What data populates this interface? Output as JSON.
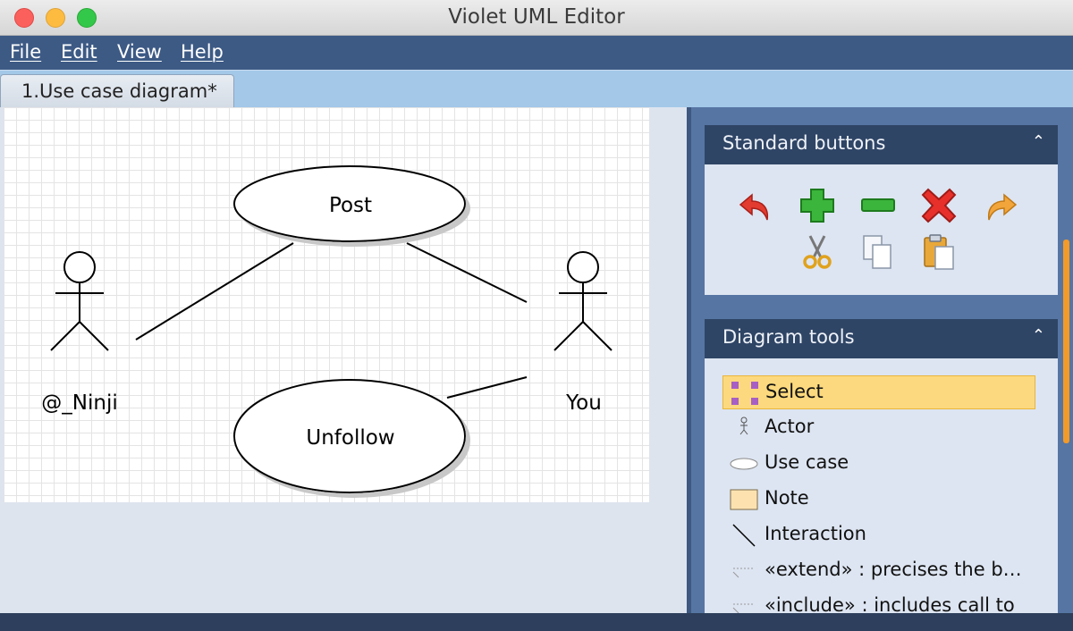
{
  "window": {
    "title": "Violet UML Editor"
  },
  "menu": {
    "items": [
      "File",
      "Edit",
      "View",
      "Help"
    ]
  },
  "tabs": [
    {
      "label": "1.Use case diagram*"
    }
  ],
  "diagram": {
    "actors": [
      {
        "name": "@_Ninji"
      },
      {
        "name": "You"
      }
    ],
    "use_cases": [
      {
        "name": "Post"
      },
      {
        "name": "Unfollow"
      }
    ]
  },
  "standard_panel": {
    "title": "Standard buttons",
    "buttons": [
      "undo-icon",
      "add-icon",
      "remove-icon",
      "delete-icon",
      "redo-icon",
      "cut-icon",
      "copy-icon",
      "paste-icon"
    ]
  },
  "tools_panel": {
    "title": "Diagram tools",
    "items": [
      {
        "label": "Select",
        "icon": "select-icon",
        "selected": true
      },
      {
        "label": "Actor",
        "icon": "actor-icon"
      },
      {
        "label": "Use case",
        "icon": "use-case-icon"
      },
      {
        "label": "Note",
        "icon": "note-icon"
      },
      {
        "label": "Interaction",
        "icon": "interaction-icon"
      },
      {
        "label": "«extend» : precises the b…",
        "icon": "extend-icon"
      },
      {
        "label": "«include» : includes call to",
        "icon": "include-icon"
      }
    ]
  },
  "colors": {
    "menubar": "#3d5a85",
    "panel_header": "#2f4566",
    "selection": "#fcd97e",
    "accent": "#f29a2a"
  }
}
